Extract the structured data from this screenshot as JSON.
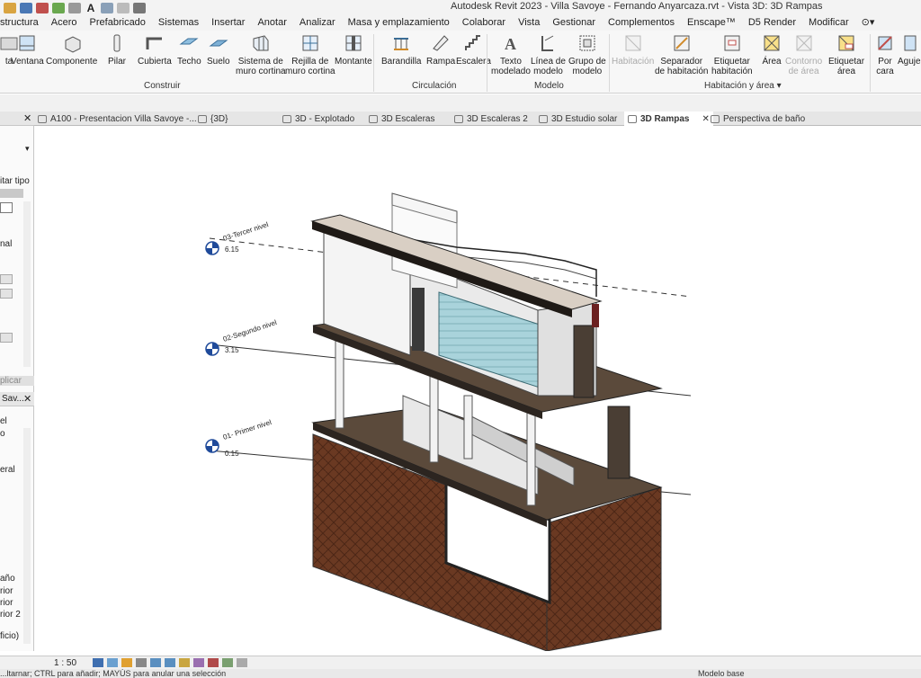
{
  "window": {
    "title": "Autodesk Revit 2023 - Villa Savoye - Fernando Anyarcaza.rvt - Vista 3D: 3D Rampas"
  },
  "ribbon_tabs": [
    "structura",
    "Acero",
    "Prefabricado",
    "Sistemas",
    "Insertar",
    "Anotar",
    "Analizar",
    "Masa y emplazamiento",
    "Colaborar",
    "Vista",
    "Gestionar",
    "Complementos",
    "Enscape™",
    "D5 Render",
    "Modificar"
  ],
  "ribbon": {
    "construir": {
      "title": "Construir",
      "buttons": [
        {
          "label": "ta"
        },
        {
          "label": "Ventana"
        },
        {
          "label": "Componente"
        },
        {
          "label": "Pilar"
        },
        {
          "label": "Cubierta"
        },
        {
          "label": "Techo"
        },
        {
          "label": "Suelo"
        },
        {
          "label": "Sistema de\nmuro cortina"
        },
        {
          "label": "Rejilla de\nmuro cortina"
        },
        {
          "label": "Montante"
        }
      ]
    },
    "circulacion": {
      "title": "Circulación",
      "buttons": [
        {
          "label": "Barandilla"
        },
        {
          "label": "Rampa"
        },
        {
          "label": "Escalera"
        }
      ]
    },
    "modelo": {
      "title": "Modelo",
      "buttons": [
        {
          "label": "Texto\nmodelado"
        },
        {
          "label": "Línea de\nmodelo"
        },
        {
          "label": "Grupo de\nmodelo"
        }
      ]
    },
    "habitacion": {
      "title": "Habitación y área",
      "buttons": [
        {
          "label": "Habitación"
        },
        {
          "label": "Separador\nde habitación"
        },
        {
          "label": "Etiquetar\nhabitación"
        },
        {
          "label": "Área"
        },
        {
          "label": "Contorno\nde área"
        },
        {
          "label": "Etiquetar\nárea"
        }
      ]
    },
    "extra": {
      "buttons": [
        {
          "label": "Por\ncara"
        },
        {
          "label": "Agujer"
        }
      ]
    }
  },
  "view_tabs": [
    {
      "label": "A100 - Presentacion Villa Savoye -..."
    },
    {
      "label": "{3D}"
    },
    {
      "label": "3D - Explotado"
    },
    {
      "label": "3D Escaleras"
    },
    {
      "label": "3D Escaleras 2"
    },
    {
      "label": "3D Estudio solar"
    },
    {
      "label": "3D Rampas",
      "active": true
    },
    {
      "label": "Perspectiva de baño"
    }
  ],
  "left_palette": {
    "properties_edit_type": "itar tipo",
    "apply_button": "plicar",
    "browser_title": "Sav...",
    "browser_items": [
      "el",
      "o",
      "eral",
      "año",
      "rior",
      "rior",
      "rior 2",
      "ficio)"
    ],
    "browser_items_mid": [
      "nal"
    ]
  },
  "levels": [
    {
      "name": "03-Tercer nivel",
      "elevation": "6.15"
    },
    {
      "name": "02-Segundo nivel",
      "elevation": "3.15"
    },
    {
      "name": "01- Primer nivel",
      "elevation": "0.15"
    }
  ],
  "view_control_bar": {
    "scale": "1 : 50"
  },
  "status_bar": {
    "hint": "...ltarnar; CTRL para añadir; MAYÚS para anular una selección",
    "right_field": "Modelo base"
  }
}
